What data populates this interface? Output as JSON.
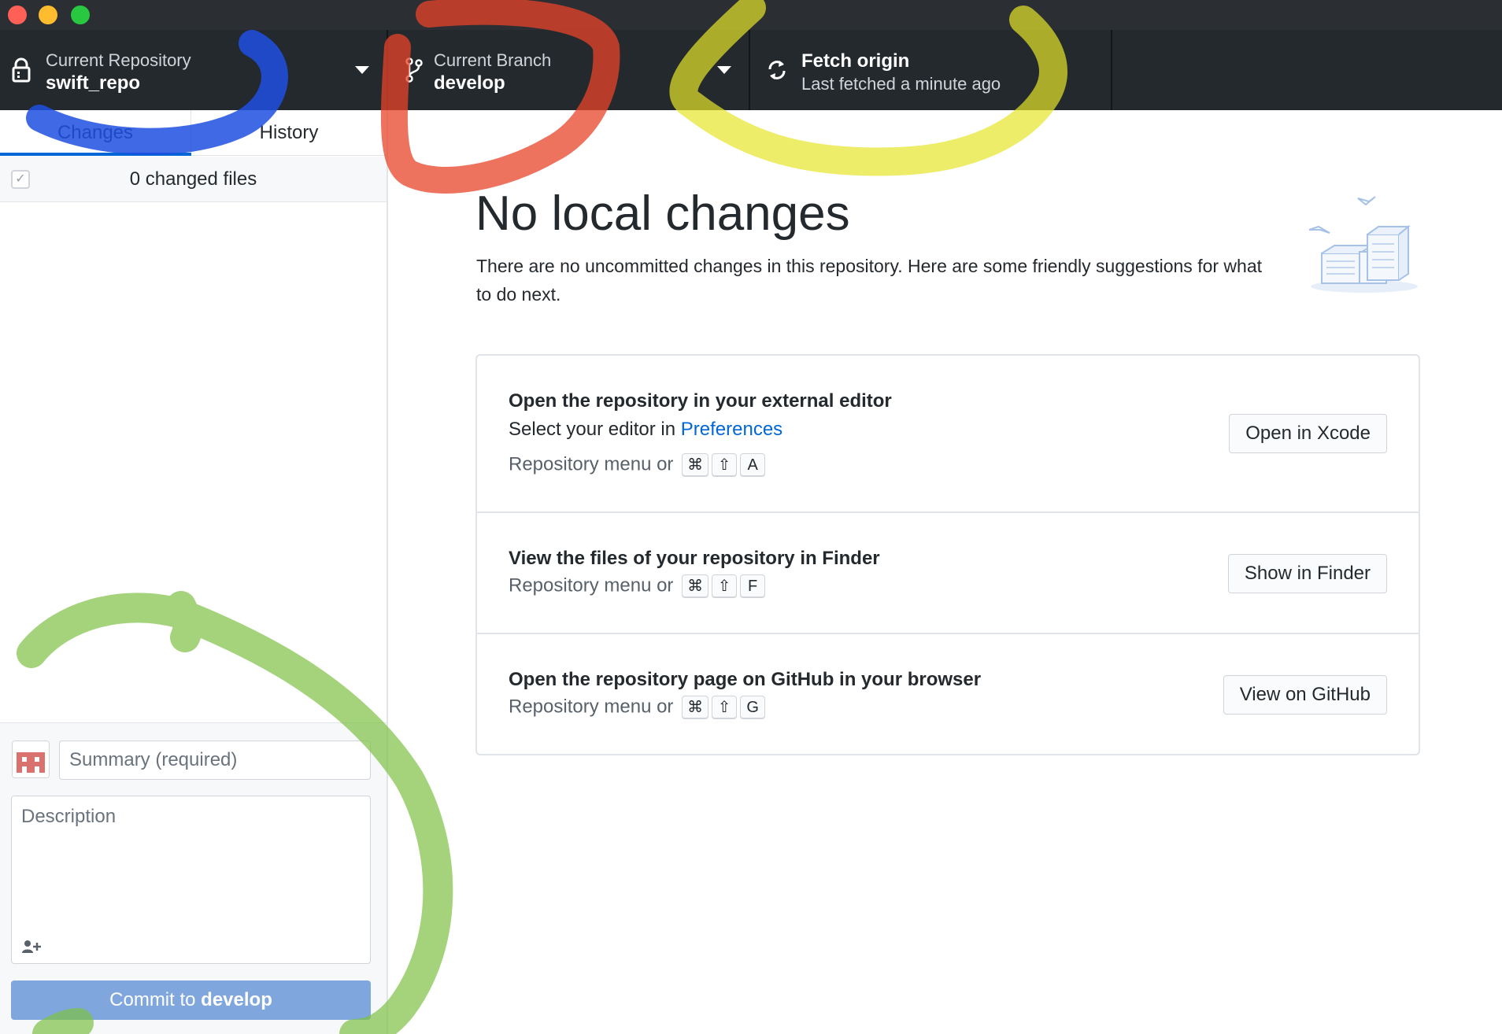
{
  "toolbar": {
    "repo_label": "Current Repository",
    "repo_value": "swift_repo",
    "branch_label": "Current Branch",
    "branch_value": "develop",
    "fetch_title": "Fetch origin",
    "fetch_sub": "Last fetched a minute ago"
  },
  "sidebar": {
    "tab_changes": "Changes",
    "tab_history": "History",
    "changed_files": "0 changed files",
    "summary_placeholder": "Summary (required)",
    "description_placeholder": "Description",
    "commit_prefix": "Commit to ",
    "commit_branch": "develop"
  },
  "main": {
    "heading": "No local changes",
    "intro": "There are no uncommitted changes in this repository. Here are some friendly suggestions for what to do next.",
    "cards": [
      {
        "title": "Open the repository in your external editor",
        "line_prefix": "Select your editor in ",
        "line_link": "Preferences",
        "shortcut_prefix": "Repository menu or",
        "keys": [
          "⌘",
          "⇧",
          "A"
        ],
        "button": "Open in Xcode"
      },
      {
        "title": "View the files of your repository in Finder",
        "shortcut_prefix": "Repository menu or",
        "keys": [
          "⌘",
          "⇧",
          "F"
        ],
        "button": "Show in Finder"
      },
      {
        "title": "Open the repository page on GitHub in your browser",
        "shortcut_prefix": "Repository menu or",
        "keys": [
          "⌘",
          "⇧",
          "G"
        ],
        "button": "View on GitHub"
      }
    ]
  },
  "colors": {
    "toolbar_bg": "#24292e",
    "accent": "#0366d6",
    "commit_button": "#7fa7de",
    "annotation_blue": "#1f4fe0",
    "annotation_red": "#e8442a",
    "annotation_yellow": "#e6e62a",
    "annotation_green": "#7dc144"
  },
  "icons": [
    "lock-icon",
    "branch-icon",
    "sync-icon",
    "caret-down-icon",
    "checkbox-icon",
    "avatar-icon",
    "add-coauthor-icon",
    "illustration-boxes"
  ]
}
